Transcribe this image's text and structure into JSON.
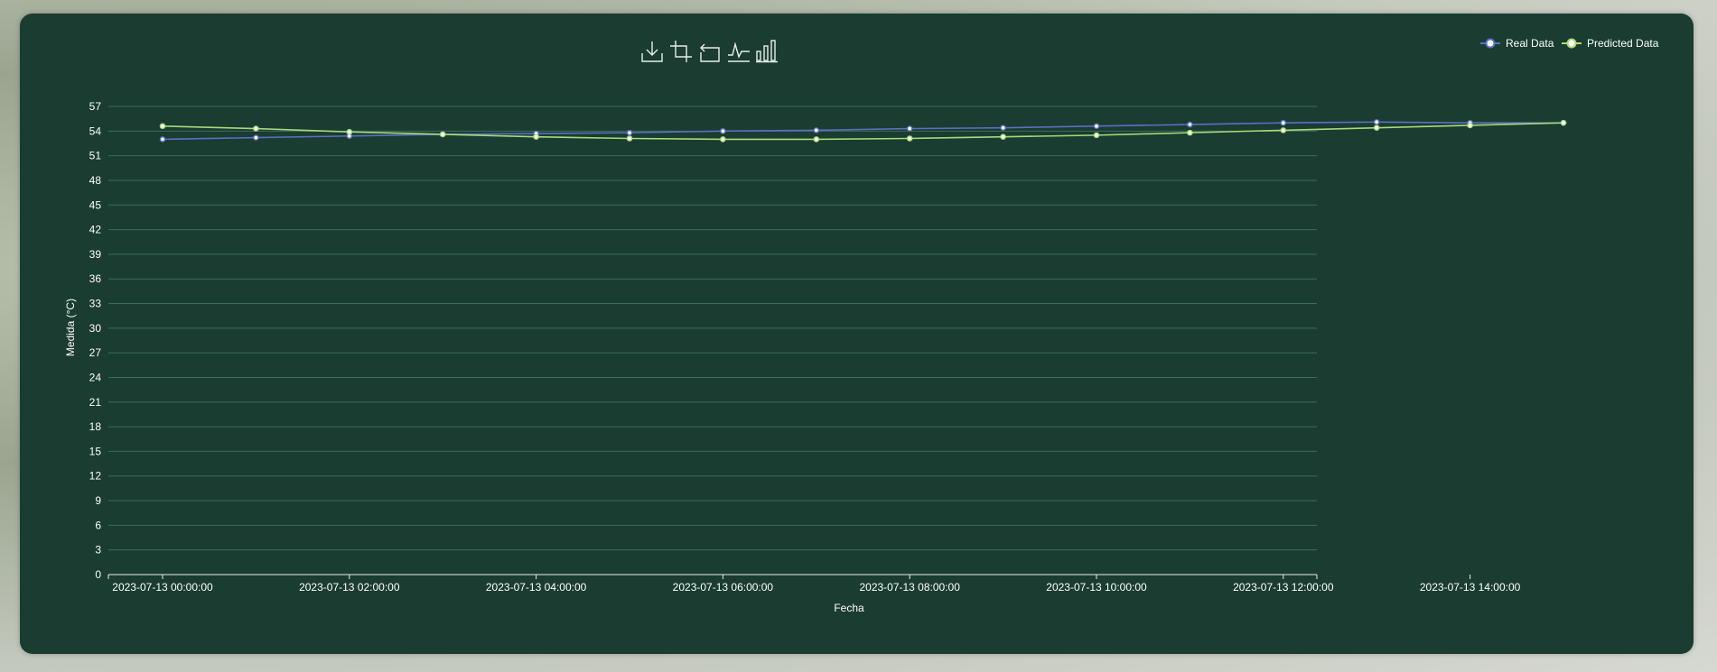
{
  "toolbox": {
    "icons": [
      "download-icon",
      "zoom-select-icon",
      "zoom-reset-icon",
      "line-chart-icon",
      "bar-chart-icon"
    ]
  },
  "colors": {
    "background": "#1a3c31",
    "grid": "#3f6b5b",
    "text": "#ffffff",
    "real": "#5b6fc0",
    "predicted": "#a9d97a"
  },
  "chart_data": {
    "type": "line",
    "xlabel": "Fecha",
    "ylabel": "Medida (°C)",
    "ylim": [
      0,
      57
    ],
    "y_ticks": [
      0,
      3,
      6,
      9,
      12,
      15,
      18,
      21,
      24,
      27,
      30,
      33,
      36,
      39,
      42,
      45,
      48,
      51,
      54,
      57
    ],
    "x_tick_labels": [
      "2023-07-13 00:00:00",
      "2023-07-13 02:00:00",
      "2023-07-13 04:00:00",
      "2023-07-13 06:00:00",
      "2023-07-13 08:00:00",
      "2023-07-13 10:00:00",
      "2023-07-13 12:00:00",
      "2023-07-13 14:00:00"
    ],
    "x": [
      "2023-07-13 00:00:00",
      "2023-07-13 01:00:00",
      "2023-07-13 02:00:00",
      "2023-07-13 03:00:00",
      "2023-07-13 04:00:00",
      "2023-07-13 05:00:00",
      "2023-07-13 06:00:00",
      "2023-07-13 07:00:00",
      "2023-07-13 08:00:00",
      "2023-07-13 09:00:00",
      "2023-07-13 10:00:00",
      "2023-07-13 11:00:00",
      "2023-07-13 12:00:00",
      "2023-07-13 13:00:00",
      "2023-07-13 14:00:00",
      "2023-07-13 15:00:00"
    ],
    "legend_position": "top-right",
    "grid": true,
    "series": [
      {
        "name": "Real Data",
        "values": [
          53.0,
          53.2,
          53.4,
          53.6,
          53.7,
          53.8,
          54.0,
          54.1,
          54.3,
          54.4,
          54.6,
          54.8,
          55.0,
          55.1,
          55.0,
          55.0
        ]
      },
      {
        "name": "Predicted Data",
        "values": [
          54.6,
          54.3,
          53.9,
          53.6,
          53.3,
          53.1,
          53.0,
          53.0,
          53.1,
          53.3,
          53.5,
          53.8,
          54.1,
          54.4,
          54.7,
          55.0
        ]
      }
    ]
  }
}
